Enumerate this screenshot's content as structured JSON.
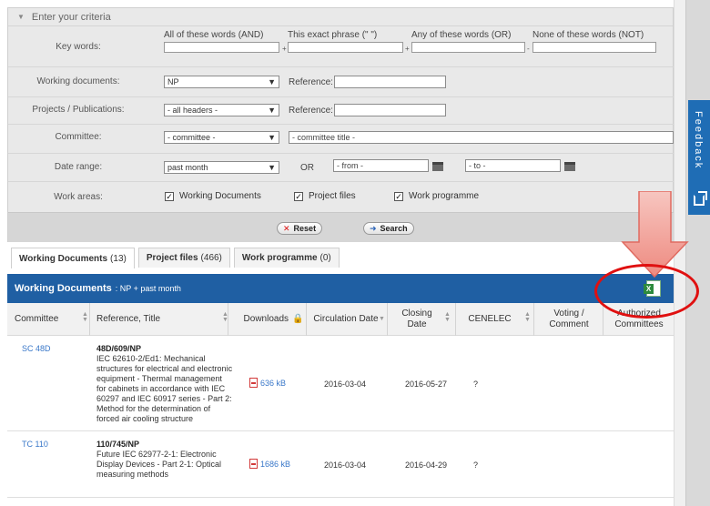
{
  "criteria": {
    "header": "Enter your criteria",
    "keywords": {
      "label": "Key words:",
      "and_label": "All of these words (AND)",
      "exact_label": "This exact phrase (\" \")",
      "or_label": "Any of these words (OR)",
      "not_label": "None of these words (NOT)",
      "plus": "+",
      "minus": "-"
    },
    "working_docs": {
      "label": "Working documents:",
      "value": "NP",
      "ref_label": "Reference:"
    },
    "projects": {
      "label": "Projects / Publications:",
      "value": "- all headers -",
      "ref_label": "Reference:"
    },
    "committee": {
      "label": "Committee:",
      "value": "- committee -",
      "title_value": "- committee title -"
    },
    "date_range": {
      "label": "Date range:",
      "value": "past month",
      "or": "OR",
      "from": "- from -",
      "to": "- to -"
    },
    "work_areas": {
      "label": "Work areas:",
      "items": [
        "Working Documents",
        "Project files",
        "Work programme"
      ]
    },
    "reset": "Reset",
    "search": "Search"
  },
  "tabs": [
    {
      "name": "Working Documents",
      "count": "(13)"
    },
    {
      "name": "Project files",
      "count": "(466)"
    },
    {
      "name": "Work programme",
      "count": "(0)"
    }
  ],
  "results": {
    "title": "Working Documents",
    "filter": ": NP + past month",
    "columns": [
      "Committee",
      "Reference, Title",
      "Downloads",
      "Circulation Date",
      "Closing Date",
      "CENELEC",
      "Voting / Comment",
      "Authorized Committees"
    ],
    "rows": [
      {
        "committee": "SC 48D",
        "ref": "48D/609/NP",
        "title": "IEC 62610-2/Ed1: Mechanical structures for electrical and electronic equipment - Thermal management for cabinets in accordance with IEC 60297 and IEC 60917 series - Part 2: Method for the determination of forced air cooling structure",
        "download": "636 kB",
        "circulation": "2016-03-04",
        "closing": "2016-05-27",
        "cenelec": "?"
      },
      {
        "committee": "TC 110",
        "ref": "110/745/NP",
        "title": "Future IEC 62977-2-1: Electronic Display Devices - Part 2-1: Optical measuring methods",
        "download": "1686 kB",
        "circulation": "2016-03-04",
        "closing": "2016-04-29",
        "cenelec": "?"
      }
    ]
  },
  "feedback": "Feedback",
  "colors": {
    "accent": "#1f5fa3",
    "highlight": "#e01010"
  },
  "icons": [
    "chevron-down-icon",
    "calendar-icon",
    "checkbox-icon",
    "reset-icon",
    "search-icon",
    "excel-export-icon",
    "pdf-icon",
    "sort-icon",
    "lock-icon",
    "share-icon"
  ]
}
